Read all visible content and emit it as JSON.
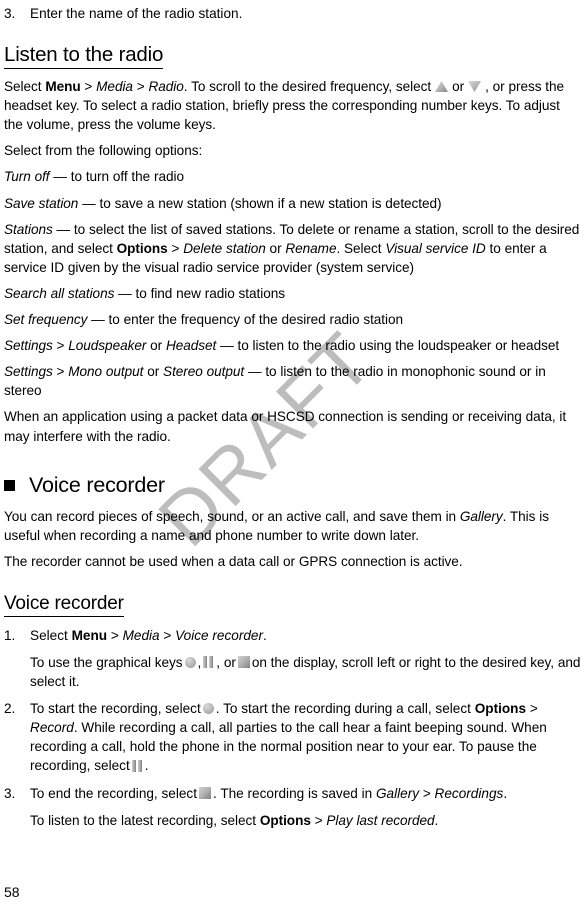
{
  "document": {
    "page_number": "58",
    "watermark": "DRAFT"
  },
  "radio_step": {
    "number": "3.",
    "text": "Enter the name of the radio station."
  },
  "listen_section": {
    "heading": "Listen to the radio",
    "intro": {
      "p1_select": "Select ",
      "p1_menu": "Menu",
      "p1_gt1": " > ",
      "p1_media": "Media",
      "p1_gt2": " > ",
      "p1_radio": "Radio",
      "p1_tail1": ". To scroll to the desired frequency, select",
      "p1_or": "or",
      "p1_tail2": ", or press the headset key. To select a radio station, briefly press the corresponding number keys. To adjust the volume, press the volume keys."
    },
    "options_lead": "Select from the following options:",
    "options": [
      {
        "term": "Turn off",
        "dash": " — ",
        "desc": "to turn off the radio"
      },
      {
        "term": "Save station",
        "dash": " — ",
        "desc": "to save a new station (shown if a new station is detected)"
      },
      {
        "term": "Stations",
        "dash": " — ",
        "desc_a": "to select the list of saved stations. To delete or rename a station, scroll to the desired station, and select ",
        "bold_options": "Options",
        "gt1": " > ",
        "italic_delete": "Delete station",
        "or": " or ",
        "italic_rename": "Rename",
        "desc_b": ". Select ",
        "italic_visual": "Visual service ID",
        "desc_c": " to enter a service ID given by the visual radio service provider (system service)"
      },
      {
        "term": "Search all stations",
        "dash": " — ",
        "desc": "to find new radio stations"
      },
      {
        "term": "Set frequency",
        "dash": " — ",
        "desc": "to enter the frequency of the desired radio station"
      },
      {
        "term_a": "Settings",
        "gt": " > ",
        "term_b": "Loudspeaker",
        "or": " or ",
        "term_c": "Headset",
        "dash": " — ",
        "desc": "to listen to the radio using the loudspeaker or headset"
      },
      {
        "term_a": "Settings",
        "gt": " > ",
        "term_b": "Mono output",
        "or": " or ",
        "term_c": "Stereo output",
        "dash": " — ",
        "desc": "to listen to the radio in monophonic sound or in stereo"
      }
    ],
    "note": "When an application using a packet data or HSCSD connection is sending or receiving data, it may interfere with the radio."
  },
  "voice_recorder_section": {
    "heading": "Voice recorder",
    "intro_a": "You can record pieces of speech, sound, or an active call, and save them in ",
    "intro_gallery": "Gallery",
    "intro_b": ". This is useful when recording a name and phone number to write down later.",
    "note": "The recorder cannot be used when a data call or GPRS connection is active.",
    "sub_heading": "Voice recorder",
    "steps": [
      {
        "number": "1.",
        "select": "Select ",
        "menu": "Menu",
        "gt1": " > ",
        "media": "Media",
        "gt2": " > ",
        "voice_recorder": "Voice recorder",
        "period": ".",
        "sub_a": "To use the graphical keys",
        "sub_comma1": ",",
        "sub_comma2": ", or",
        "sub_b": "on the display, scroll left or right to the desired key, and select it."
      },
      {
        "number": "2.",
        "a": "To start the recording, select",
        "b": ". To start the recording during a call, select ",
        "options": "Options",
        "gt": " > ",
        "record": "Record",
        "c": ". While recording a call, all parties to the call hear a faint beeping sound. When recording a call, hold the phone in the normal position near to your ear. To pause the recording, select",
        "d": "."
      },
      {
        "number": "3.",
        "a": "To end the recording, select",
        "b": ". The recording is saved in ",
        "gallery": "Gallery",
        "gt": " > ",
        "recordings": "Recordings",
        "c": ".",
        "sub_a": "To listen to the latest recording, select ",
        "sub_options": "Options",
        "sub_gt": " > ",
        "sub_play": "Play last recorded",
        "sub_b": "."
      }
    ]
  },
  "icons": {
    "scroll_up": "triangle-up-icon",
    "scroll_down": "triangle-down-icon",
    "record": "record-circle-icon",
    "pause": "pause-bars-icon",
    "stop": "stop-square-icon",
    "section_bullet": "square-bullet-icon"
  },
  "colors": {
    "text": "#000000",
    "watermark": "#bdbdbd",
    "page_background": "#ffffff"
  }
}
